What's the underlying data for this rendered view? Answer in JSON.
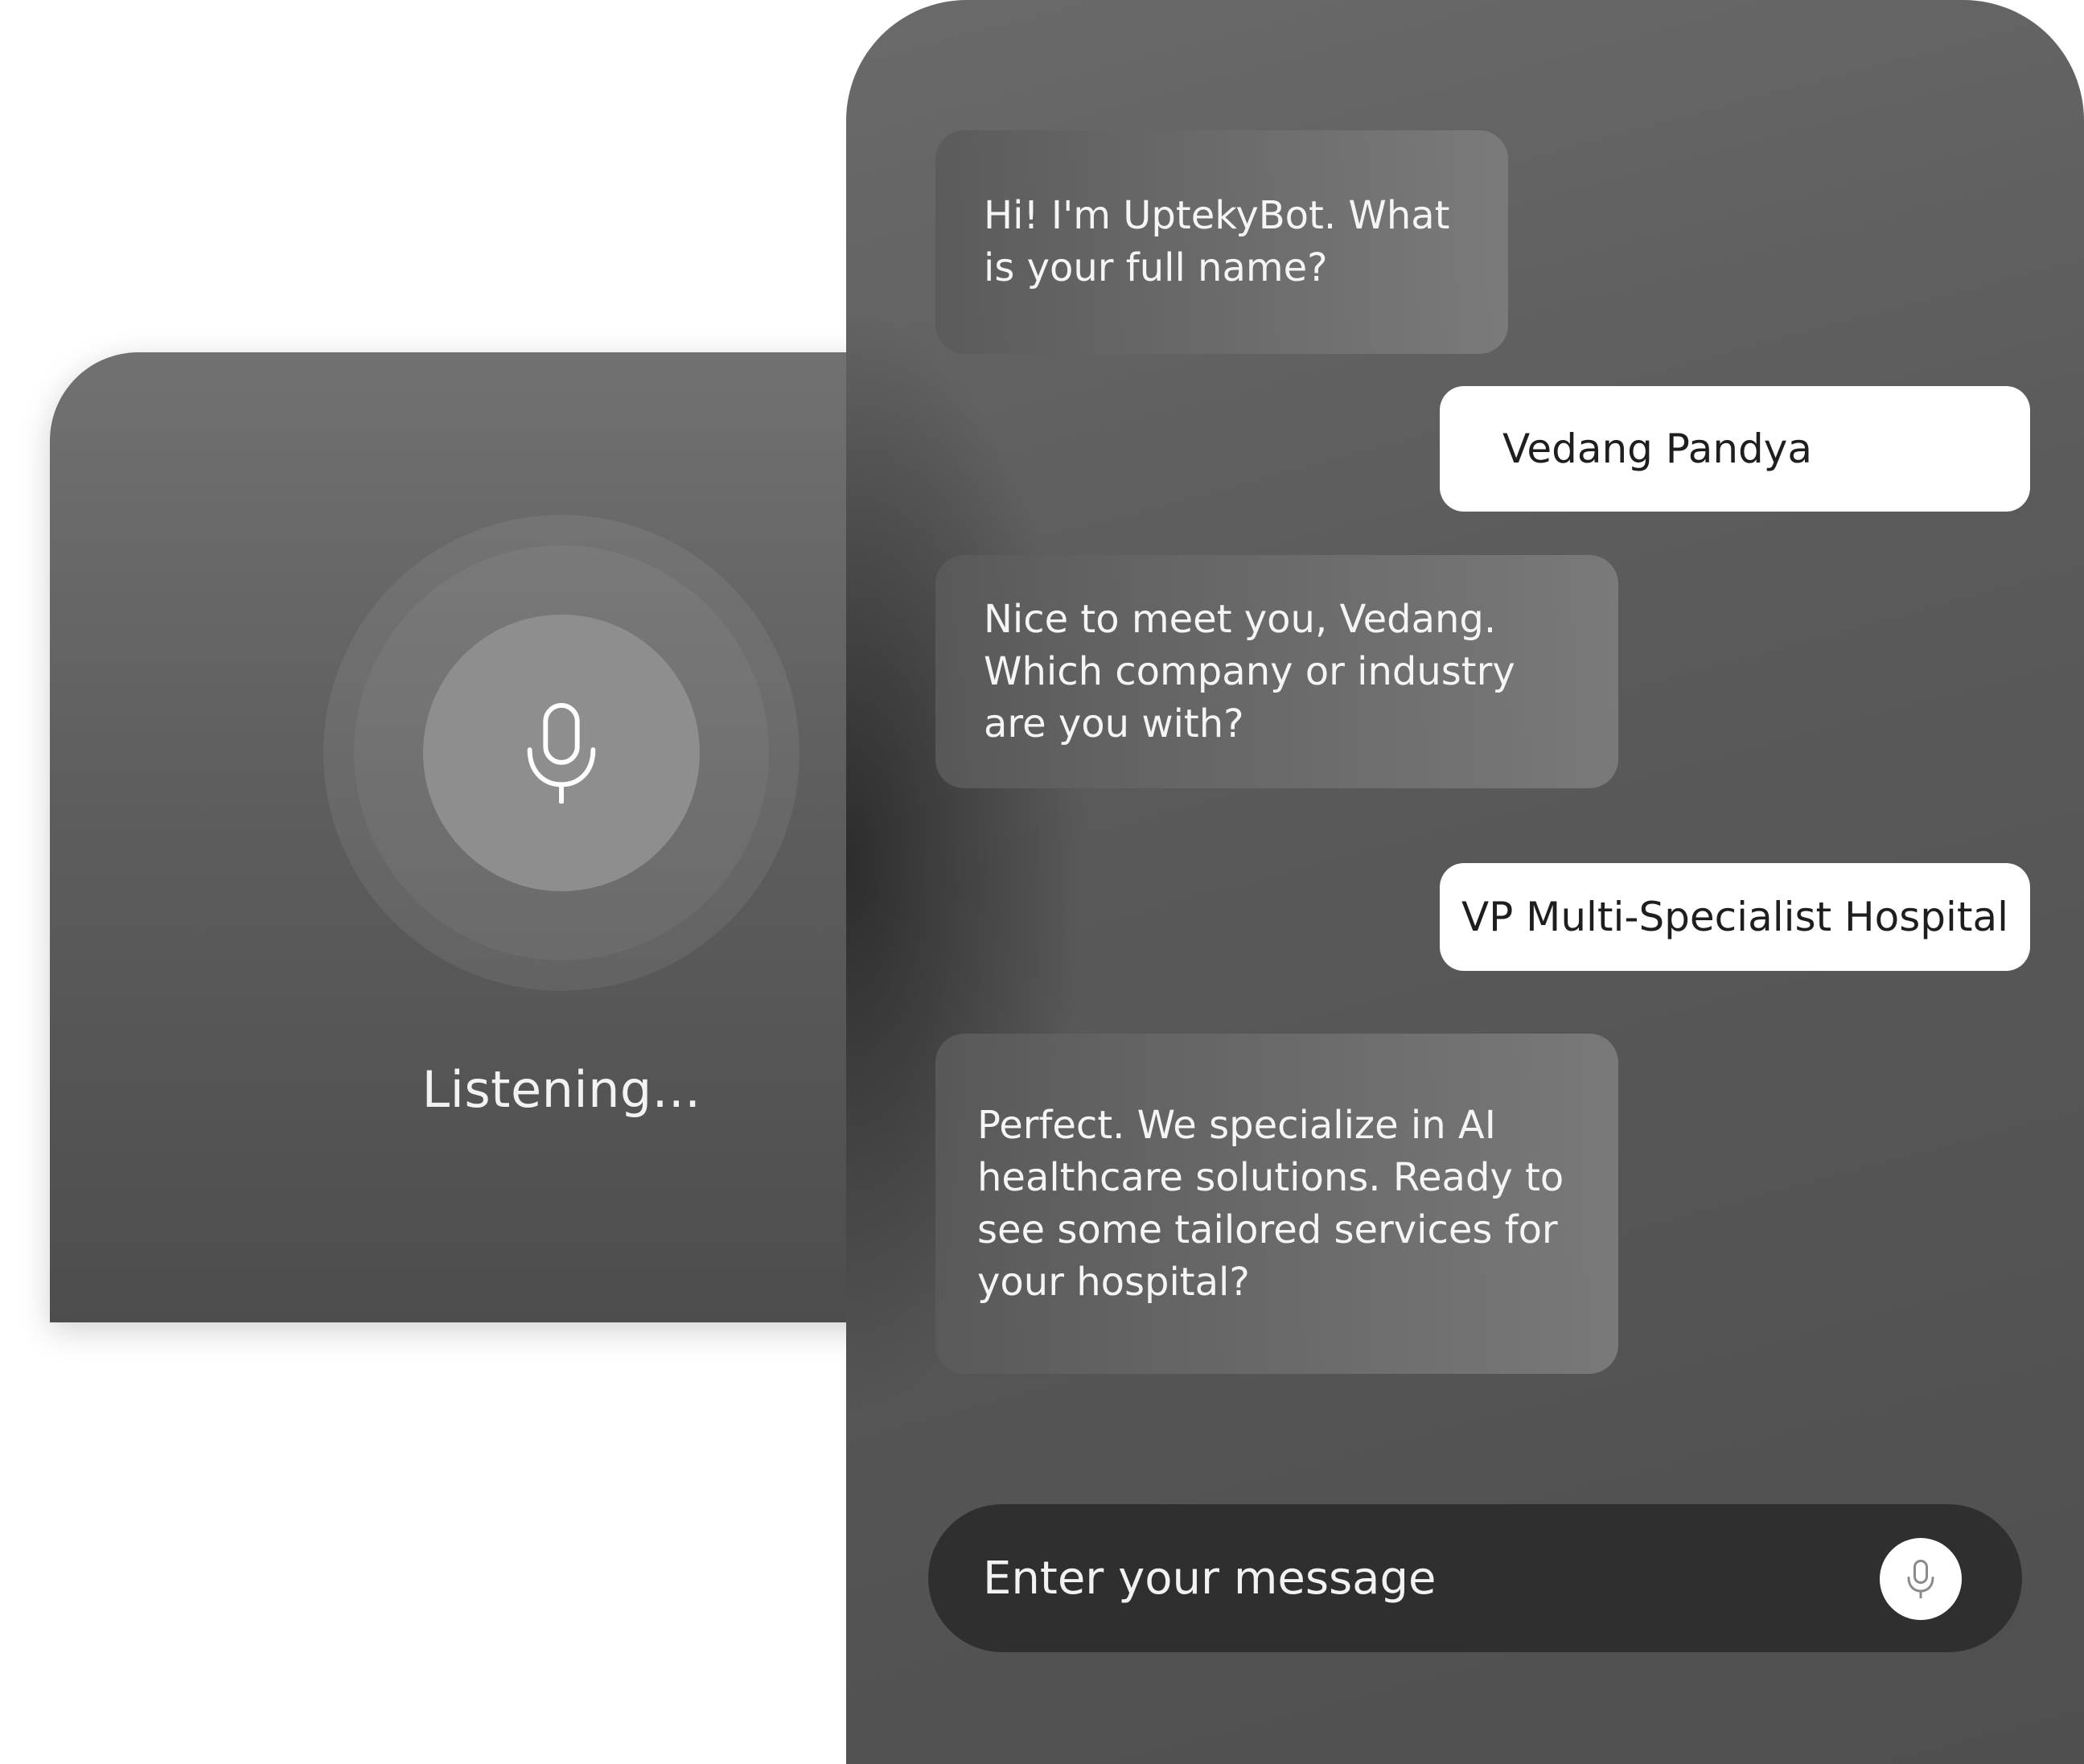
{
  "voice": {
    "status_label": "Listening...",
    "mic_icon": "microphone-icon"
  },
  "chat": {
    "messages": [
      {
        "sender": "bot",
        "text": "Hi! I'm UptekyBot. What is your full name?"
      },
      {
        "sender": "user",
        "text": "Vedang Pandya"
      },
      {
        "sender": "bot",
        "text": "Nice to meet you, Vedang. Which company or industry are you with?"
      },
      {
        "sender": "user",
        "text": "VP Multi-Specialist Hospital"
      },
      {
        "sender": "bot",
        "text": "Perfect. We specialize in AI healthcare solutions. Ready to see some tailored services for your hospital?"
      }
    ]
  },
  "composer": {
    "placeholder": "Enter your message",
    "mic_icon": "microphone-icon"
  },
  "colors": {
    "user_bubble": "#ffffff",
    "composer_bg": "#2f2f2f",
    "mic_button": "#8e8e8e"
  }
}
